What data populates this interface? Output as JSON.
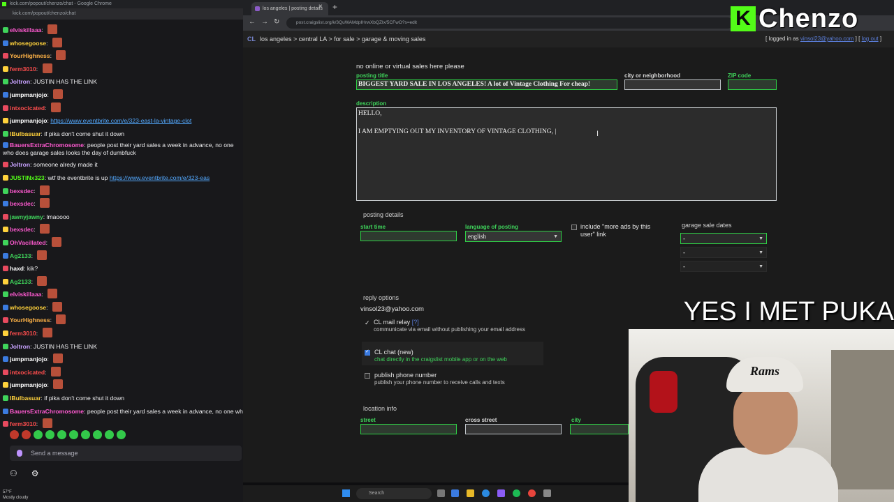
{
  "chat_window": {
    "title": "kick.com/popout/chenzo/chat - Google Chrome",
    "url": "kick.com/popout/chenzo/chat",
    "input_placeholder": "Send a message",
    "messages": [
      {
        "user": "elviskillaaa",
        "text": "",
        "color": "#ff5ad1"
      },
      {
        "user": "whosegoose",
        "text": "",
        "color": "#ffd23c"
      },
      {
        "user": "YourHighness",
        "text": "",
        "color": "#ffb347"
      },
      {
        "user": "ferm3010",
        "text": "",
        "color": "#ff4d4d"
      },
      {
        "user": "Joltron",
        "text": "JUSTIN HAS THE LINK",
        "color": "#c8a2ff"
      },
      {
        "user": "jumpmanjojo",
        "text": "",
        "color": "#ffffff"
      },
      {
        "user": "intxocicated",
        "text": "",
        "color": "#ff4d4d"
      },
      {
        "user": "jumpmanjojo",
        "text": "",
        "link": "https://www.eventbrite.com/e/323-east-la-vintage-clot",
        "color": "#ffffff"
      },
      {
        "user": "IBulbasuar",
        "text": "if pika don't come shut it down",
        "color": "#ffd23c"
      },
      {
        "user": "BauersExtraChromosome",
        "text": "people post their yard sales a week in advance, no one who does garage sales looks the day of dumbfuck",
        "color": "#ff5ad1",
        "tall": true
      },
      {
        "user": "Joltron",
        "text": "someone alredy made it",
        "color": "#c8a2ff"
      },
      {
        "user": "JUSTINx323",
        "text": "wtf the eventbrite is up",
        "link": "https://www.eventbrite.com/e/323-eas",
        "color": "#53fc18"
      },
      {
        "user": "bexsdec",
        "text": "",
        "color": "#ff5ad1"
      },
      {
        "user": "bexsdec",
        "text": "",
        "color": "#ff5ad1"
      },
      {
        "user": "jawnyjawny",
        "text": "lmaoooo",
        "color": "#3fd45b"
      },
      {
        "user": "bexsdec",
        "text": "",
        "color": "#ff5ad1"
      },
      {
        "user": "OhVacillated",
        "text": "",
        "color": "#ff5ad1"
      },
      {
        "user": "Ag2133",
        "text": "",
        "color": "#3fd45b"
      },
      {
        "user": "haxd",
        "text": "kik?",
        "color": "#ffffff"
      },
      {
        "user": "Ag2133",
        "text": "",
        "color": "#3fd45b"
      },
      {
        "user": "elviskillaaa",
        "text": "",
        "color": "#ff5ad1"
      },
      {
        "user": "whosegoose",
        "text": "",
        "color": "#ffd23c"
      },
      {
        "user": "YourHighness",
        "text": "",
        "color": "#ffb347"
      },
      {
        "user": "ferm3010",
        "text": "",
        "color": "#ff4d4d"
      },
      {
        "user": "Joltron",
        "text": "JUSTIN HAS THE LINK",
        "color": "#c8a2ff"
      },
      {
        "user": "jumpmanjojo",
        "text": "",
        "color": "#ffffff"
      },
      {
        "user": "intxocicated",
        "text": "",
        "color": "#ff4d4d"
      },
      {
        "user": "jumpmanjojo",
        "text": "",
        "color": "#ffffff"
      },
      {
        "user": "IBulbasuar",
        "text": "if pika don't come shut it down",
        "color": "#ffd23c"
      },
      {
        "user": "BauersExtraChromosome",
        "text": "people post their yard sales a week in advance, no one who",
        "color": "#ff5ad1"
      },
      {
        "user": "ferm3010",
        "text": "",
        "color": "#ff4d4d"
      },
      {
        "user": "ferm3010",
        "text": "",
        "color": "#ff4d4d"
      }
    ],
    "weather": {
      "temp": "57°F",
      "condition": "Mostly cloudy"
    }
  },
  "browser": {
    "tab_title": "los angeles | posting details",
    "url": "post.craigslist.org/k/3QuWAMdpIHrwXbQZIx/5CFwO?s=edit"
  },
  "craigslist": {
    "logo": "CL",
    "breadcrumb": "los angeles > central LA > for sale > garage & moving sales",
    "login_prefix": "[ logged in as",
    "login_email": "vinsol23@yahoo.com",
    "logout": "log out",
    "login_suffix": "]",
    "notice": "no online or virtual sales here please",
    "posting_title_label": "posting title",
    "posting_title": "BIGGEST YARD SALE IN LOS ANGELES! A lot of Vintage Clothing For cheap!",
    "city_label": "city or neighborhood",
    "zip_label": "ZIP code",
    "description_label": "description",
    "description": "HELLO,\n\nI AM EMPTYING OUT MY INVENTORY OF VINTAGE CLOTHING, |",
    "posting_details_label": "posting details",
    "start_time_label": "start time",
    "language_label": "language of posting",
    "language_value": "english",
    "more_ads_label": "include \"more ads by this user\" link",
    "garage_dates_label": "garage sale dates",
    "date_values": [
      "-",
      "-",
      "-"
    ],
    "reply_options_label": "reply options",
    "reply_email": "vinsol23@yahoo.com",
    "mail_relay_title": "CL mail relay",
    "mail_relay_help": "[?]",
    "mail_relay_desc": "communicate via email without publishing your email address",
    "chat_title": "CL chat (new)",
    "chat_desc": "chat directly in the craigslist mobile app or on the web",
    "phone_title": "publish phone number",
    "phone_desc": "publish your phone number to receive calls and texts",
    "location_label": "location info",
    "street_label": "street",
    "cross_street_label": "cross street",
    "city_label2": "city"
  },
  "overlay": {
    "brand_letter": "K",
    "brand_name": "Chenzo",
    "caption": "YES I MET PUKA",
    "cap_text": "Rams"
  },
  "taskbar": {
    "search_placeholder": "Search"
  },
  "colors": {
    "kick_green": "#53fc18",
    "field_active": "#2fd046",
    "link_blue": "#5a7dd8"
  }
}
